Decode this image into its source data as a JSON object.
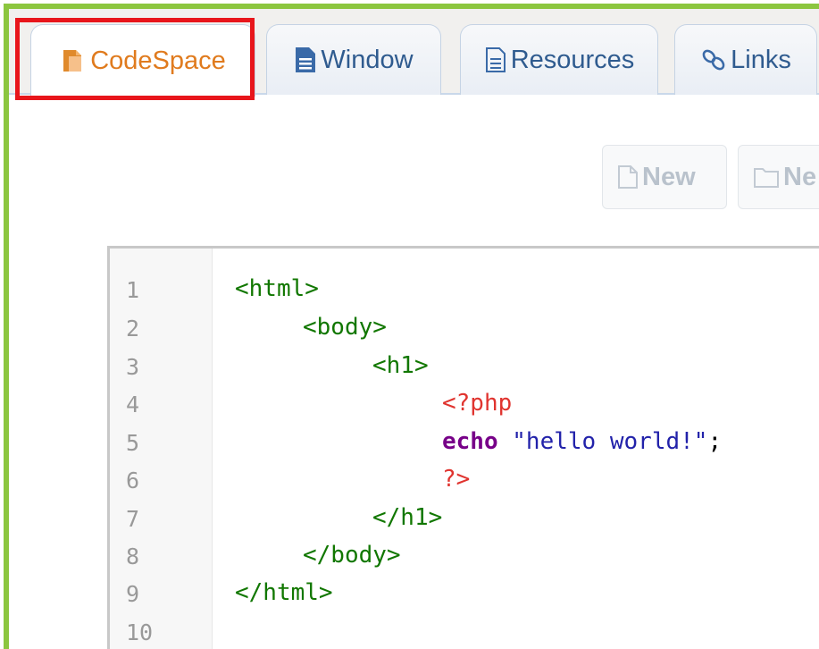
{
  "tabs": [
    {
      "label": "CodeSpace",
      "icon": "codespace-icon",
      "active": true
    },
    {
      "label": "Window",
      "icon": "document-icon",
      "active": false
    },
    {
      "label": "Resources",
      "icon": "resources-icon",
      "active": false
    },
    {
      "label": "Links",
      "icon": "link-icon",
      "active": false
    }
  ],
  "toolbar": {
    "new_file_label": "New",
    "new_folder_label": "Ne"
  },
  "editor": {
    "line_numbers": [
      "1",
      "2",
      "3",
      "4",
      "5",
      "6",
      "7",
      "8",
      "9",
      "10"
    ],
    "lines": [
      [
        {
          "type": "tag",
          "text": "<html>"
        }
      ],
      [
        {
          "type": "tag",
          "text": "<body>"
        }
      ],
      [
        {
          "type": "tag",
          "text": "<h1>"
        }
      ],
      [
        {
          "type": "meta",
          "text": "<?php"
        }
      ],
      [
        {
          "type": "keyword",
          "text": "echo"
        },
        {
          "type": "plain",
          "text": " "
        },
        {
          "type": "string",
          "text": "\"hello world!\""
        },
        {
          "type": "plain",
          "text": ";"
        }
      ],
      [
        {
          "type": "meta",
          "text": "?>"
        }
      ],
      [
        {
          "type": "tag",
          "text": "</h1>"
        }
      ],
      [
        {
          "type": "tag",
          "text": "</body>"
        }
      ],
      [
        {
          "type": "tag",
          "text": "</html>"
        }
      ],
      []
    ]
  },
  "colors": {
    "frame_border": "#8cc63f",
    "highlight": "#e8161b",
    "active_tab_text": "#e07b1e",
    "tab_text": "#2f5b8f",
    "code_tag": "#117700",
    "code_meta": "#e0342f",
    "code_keyword": "#770088",
    "code_string": "#2222aa"
  }
}
